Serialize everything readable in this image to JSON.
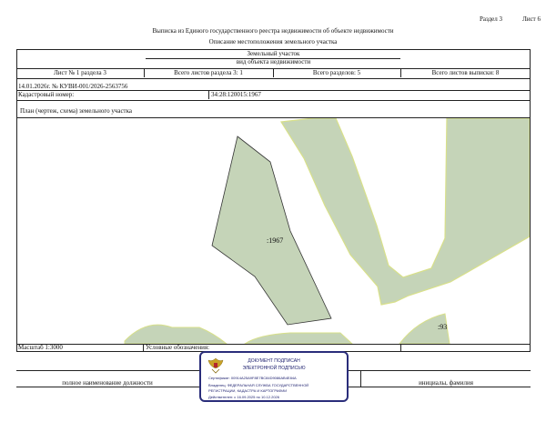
{
  "header": {
    "section_label": "Раздел 3",
    "sheet_label": "Лист 6",
    "title": "Выписка из Единого государственного реестра недвижимости об объекте недвижимости",
    "subtitle": "Описание местоположения земельного участка"
  },
  "form": {
    "object_type": "Земельный участок",
    "object_kind_caption": "вид объекта недвижимости",
    "sheet_no": "Лист № 1 раздела 3",
    "sheets_in_section": "Всего листов раздела 3: 1",
    "sections_total": "Всего разделов: 5",
    "extract_sheets_total": "Всего листов выписки: 8",
    "date_and_number": "14.01.2026г. № КУВИ-001/2026-2563756",
    "cadastral_label": "Кадастровый номер:",
    "cadastral_number": "34:28:120015:1967",
    "plan_caption": "План (чертеж, схема) земельного участка",
    "plot_label": ":1967",
    "edge_label": ":93",
    "scale": "Масштаб 1:3000",
    "legend_label": "Условные обозначения:",
    "position_caption": "полное наименование должности",
    "name_caption": "инициалы, фамилия"
  },
  "stamp": {
    "line1": "ДОКУМЕНТ ПОДПИСАН",
    "line2": "ЭЛЕКТРОННОЙ ПОДПИСЬЮ",
    "cert": "Сертификат: 00914A25A9F8E7BC84D9086AB4E84A",
    "owner1": "Владелец: ФЕДЕРАЛЬНАЯ СЛУЖБА ГОСУДАРСТВЕННОЙ",
    "owner2": "РЕГИСТРАЦИИ, КАДАСТРА И КАРТОГРАФИИ",
    "valid": "Действителен: с 16.09.2025 по 10.12.2026"
  },
  "colors": {
    "parcel_fill": "#c5d4b8",
    "parcel_border": "#d8e08a",
    "stamp_blue": "#2a2d7a",
    "emblem_red": "#b3262d"
  }
}
